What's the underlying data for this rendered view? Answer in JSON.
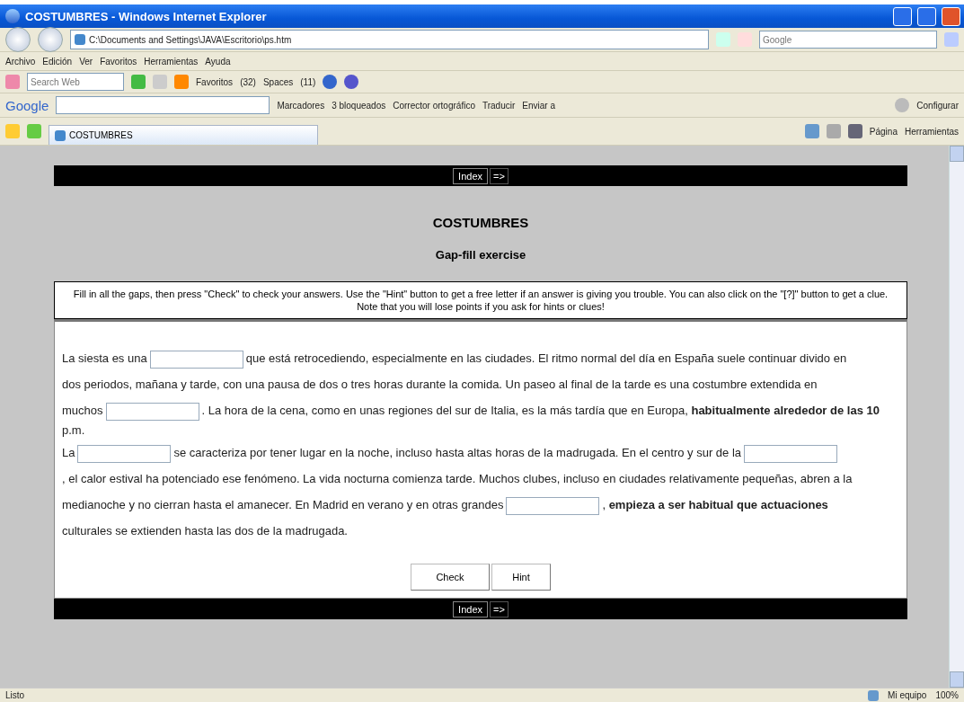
{
  "window": {
    "title": "COSTUMBRES - Windows Internet Explorer"
  },
  "address_bar": {
    "value": "C:\\Documents and Settings\\JAVA\\Escritorio\\ps.htm",
    "search_placeholder": "Google"
  },
  "menu": [
    "Archivo",
    "Edición",
    "Ver",
    "Favoritos",
    "Herramientas",
    "Ayuda"
  ],
  "toolbar": {
    "search_placeholder": "Search Web",
    "items": [
      "Favoritos",
      "(32)",
      "Spaces",
      "(11)"
    ]
  },
  "google_bar": {
    "logo": "Google",
    "items": [
      "Marcadores",
      "3 bloqueados",
      "Corrector ortográfico",
      "Traducir",
      "Enviar a"
    ],
    "settings": "Configurar"
  },
  "tab_bar": {
    "tabs": [
      {
        "label": "COSTUMBRES",
        "selected": true
      }
    ],
    "commands": [
      "Página",
      "Herramientas"
    ]
  },
  "page": {
    "nav_top": {
      "index": "Index",
      "next": "=>"
    },
    "title": "COSTUMBRES",
    "subtitle": "Gap-fill exercise",
    "instructions": "Fill in all the gaps, then press \"Check\" to check your answers. Use the \"Hint\" button to get a free letter if an answer is giving you trouble. You can also click on the \"[?]\" button to get a clue. Note that you will lose points if you ask for hints or clues!",
    "paragraphs": [
      [
        [
          {
            "kind": "text",
            "text": "La siesta es una"
          },
          {
            "kind": "gap"
          },
          {
            "kind": "text",
            "text": "que está retrocediendo, especialmente en las ciudades. El ritmo normal del día en España suele continuar divido en"
          }
        ],
        [
          {
            "kind": "text",
            "text": "dos periodos, mañana y tarde, con una pausa de dos o tres horas durante la comida. Un paseo al final de la tarde es una costumbre extendida en"
          }
        ],
        [
          {
            "kind": "text",
            "text": "muchos"
          },
          {
            "kind": "gap"
          },
          {
            "kind": "text",
            "text": ". La hora de la cena, como en unas regiones del sur de Italia, es la más tardía que en Europa, **habitualmente alrededor de las 10**"
          }
        ],
        [
          {
            "kind": "text",
            "text": "p.m."
          }
        ]
      ],
      [
        [
          {
            "kind": "text",
            "text": "La"
          },
          {
            "kind": "gap"
          },
          {
            "kind": "text",
            "text": "se caracteriza por tener lugar en la noche, incluso hasta altas horas de la madrugada. En el centro y sur de la"
          },
          {
            "kind": "gap"
          }
        ],
        [
          {
            "kind": "text",
            "text": ", el calor estival ha potenciado ese fenómeno. La vida nocturna comienza tarde. Muchos clubes, incluso en ciudades relativamente pequeñas, abren a la"
          }
        ],
        [
          {
            "kind": "text",
            "text": "medianoche y no cierran hasta el amanecer. En Madrid en verano y en otras grandes"
          },
          {
            "kind": "gap"
          },
          {
            "kind": "text",
            "text": ", **empieza a ser habitual que actuaciones**"
          }
        ],
        [
          {
            "kind": "text",
            "text": "culturales se extienden hasta las dos de la madrugada."
          }
        ]
      ]
    ],
    "buttons": [
      "Check",
      "Hint"
    ],
    "nav_bottom": {
      "index": "Index",
      "next": "=>"
    }
  },
  "status_bar": {
    "text": "Listo",
    "zone": "Mi equipo",
    "zoom": "100%"
  }
}
